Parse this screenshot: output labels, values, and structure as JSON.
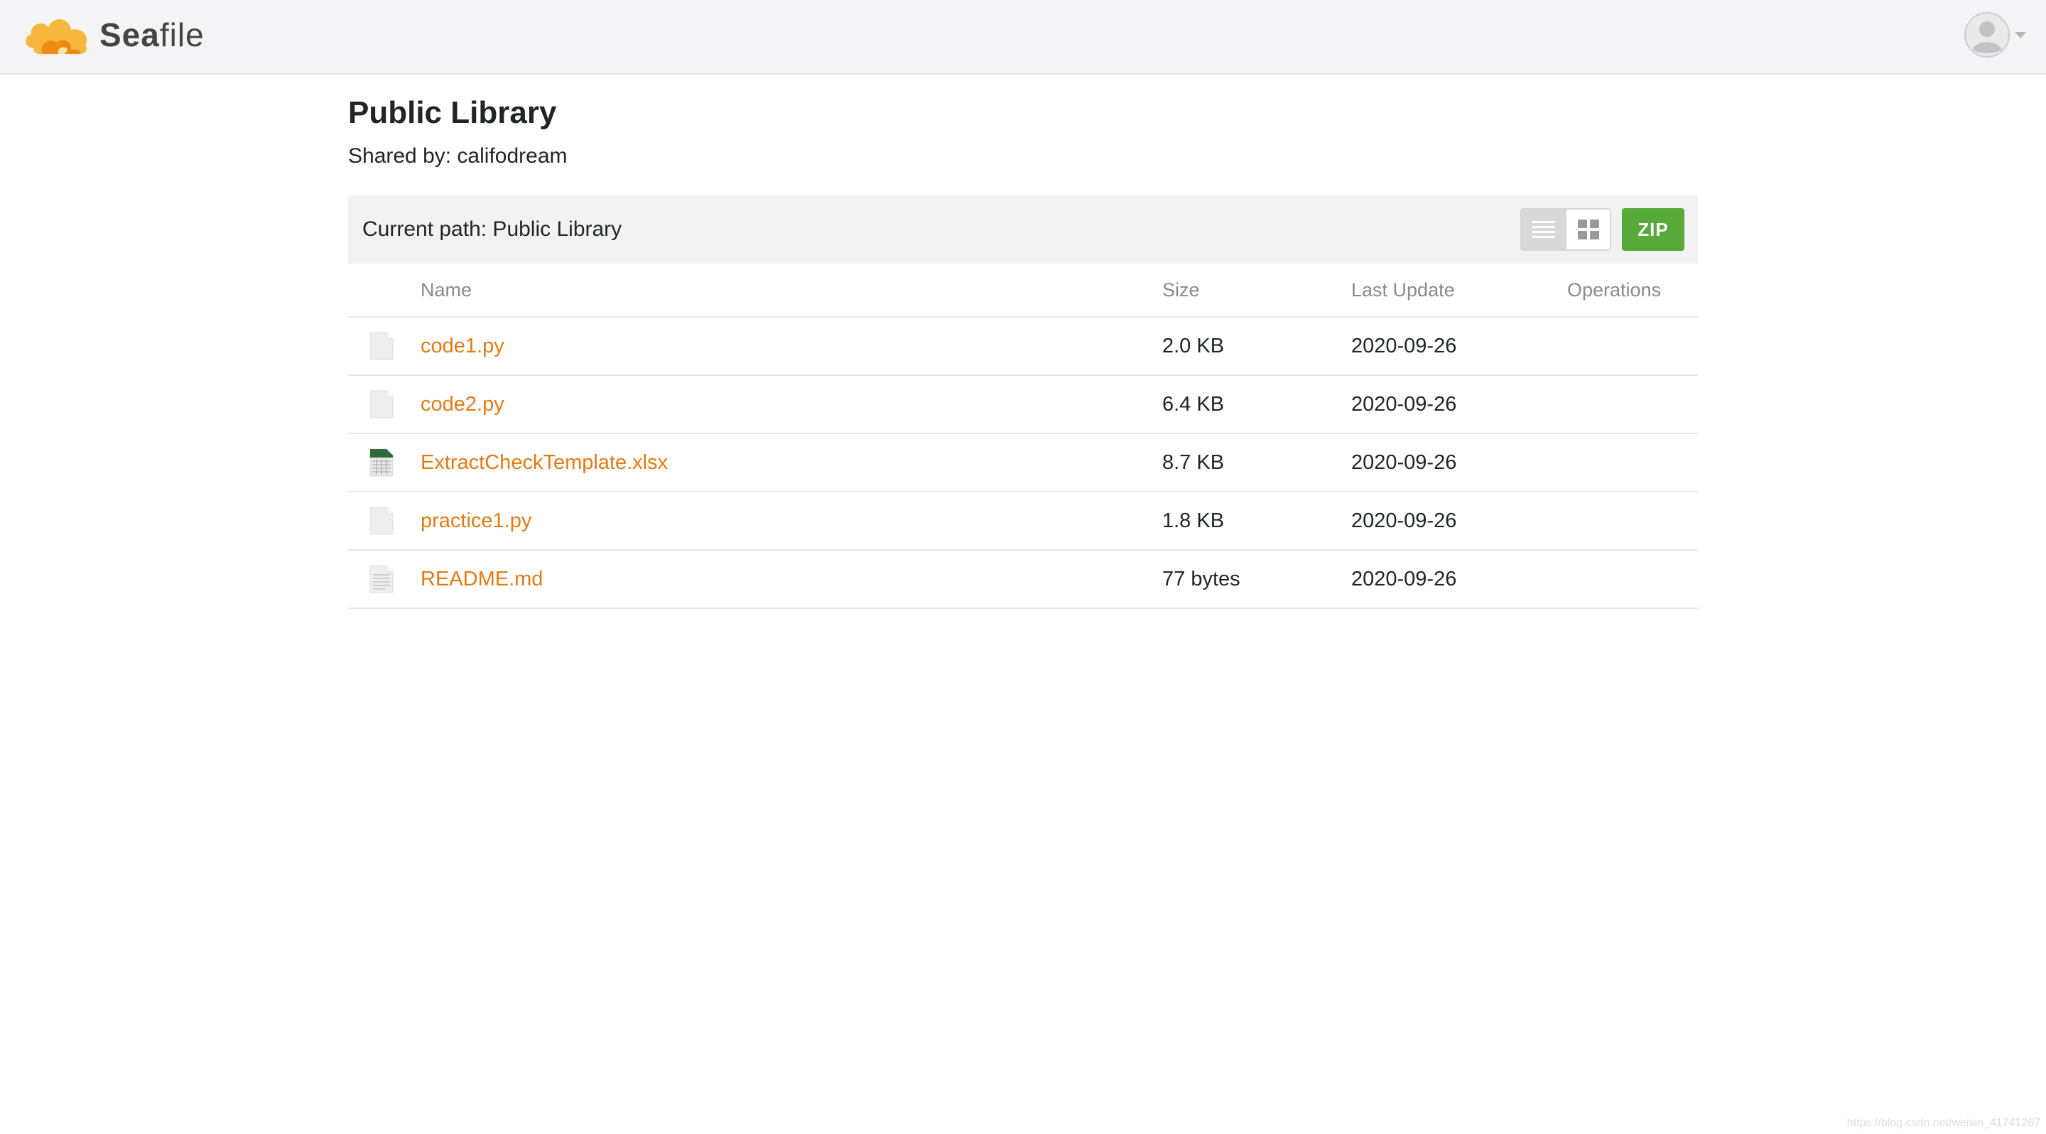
{
  "header": {
    "logo": {
      "part1": "Sea",
      "part2": "file"
    },
    "account_icon": "user-avatar-icon",
    "account_caret_icon": "chevron-down-icon"
  },
  "page": {
    "title": "Public Library",
    "shared_by": "Shared by: califodream"
  },
  "toolbar": {
    "current_path": "Current path: Public Library",
    "list_view_icon": "list-view-icon",
    "grid_view_icon": "grid-view-icon",
    "zip_label": "ZIP",
    "zip_color": "#57a93a"
  },
  "table": {
    "columns": [
      "Name",
      "Size",
      "Last Update",
      "Operations"
    ],
    "rows": [
      {
        "name": "code1.py",
        "size": "2.0 KB",
        "last_update": "2020-09-26",
        "icon": "file-icon"
      },
      {
        "name": "code2.py",
        "size": "6.4 KB",
        "last_update": "2020-09-26",
        "icon": "file-icon"
      },
      {
        "name": "ExtractCheckTemplate.xlsx",
        "size": "8.7 KB",
        "last_update": "2020-09-26",
        "icon": "spreadsheet-icon"
      },
      {
        "name": "practice1.py",
        "size": "1.8 KB",
        "last_update": "2020-09-26",
        "icon": "file-icon"
      },
      {
        "name": "README.md",
        "size": "77 bytes",
        "last_update": "2020-09-26",
        "icon": "text-file-icon"
      }
    ]
  },
  "colors": {
    "link": "#e07b15",
    "header_bg": "#f4f4f7",
    "path_bar_bg": "#f2f2f2",
    "logo_orange": "#f5a623"
  },
  "watermark": "https://blog.csdn.net/weixin_41741267"
}
